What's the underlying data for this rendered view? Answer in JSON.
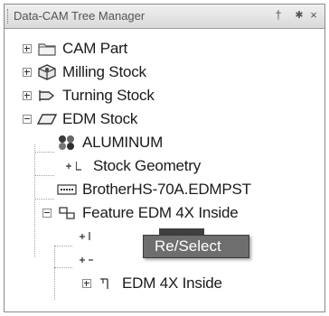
{
  "window": {
    "title": "Data-CAM Tree Manager",
    "pin_glyph": "†",
    "close_glyph": "×"
  },
  "tree": {
    "items": [
      {
        "label": "CAM Part",
        "icon": "folder-icon",
        "expander": "plus"
      },
      {
        "label": "Milling Stock",
        "icon": "milling-stock-icon",
        "expander": "plus"
      },
      {
        "label": "Turning Stock",
        "icon": "turning-stock-icon",
        "expander": "plus"
      },
      {
        "label": "EDM Stock",
        "icon": "edm-stock-icon",
        "expander": "minus"
      },
      {
        "label": "ALUMINUM",
        "icon": "material-icon"
      },
      {
        "label": "Stock Geometry",
        "icon": "stock-geometry-icon"
      },
      {
        "label": "BrotherHS-70A.EDMPST",
        "icon": "post-processor-icon"
      },
      {
        "label": "Feature EDM 4X Inside",
        "icon": "feature-icon",
        "expander": "minus"
      },
      {
        "label": "EDM 4X Inside",
        "icon": "operation-icon",
        "expander": "plus"
      }
    ]
  },
  "context_menu": {
    "items": [
      {
        "label": "Re/Select"
      }
    ]
  }
}
